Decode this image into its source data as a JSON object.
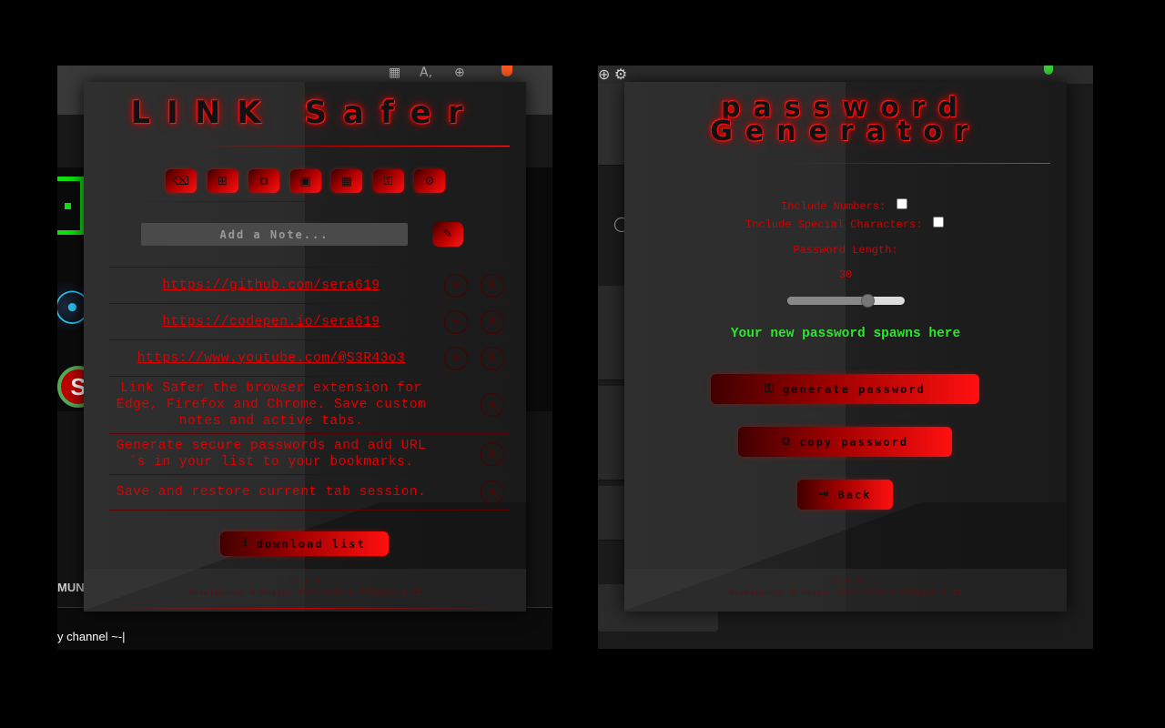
{
  "left_background": {
    "bottom_caption": "MUN",
    "channel_text": "y channel ~-|"
  },
  "link_safer": {
    "title": "LINK Safer",
    "toolbar": [
      {
        "icon": "eraser-icon",
        "glyph": "⌫"
      },
      {
        "icon": "add-bookmark-icon",
        "glyph": "⊞"
      },
      {
        "icon": "tab-copy-icon",
        "glyph": "⧉"
      },
      {
        "icon": "windows-icon",
        "glyph": "▣"
      },
      {
        "icon": "calendar-icon",
        "glyph": "▦"
      },
      {
        "icon": "key-icon",
        "glyph": "⚿"
      },
      {
        "icon": "gear-icon",
        "glyph": "⚙"
      }
    ],
    "note_placeholder": "Add a Note...",
    "note_save_icon": "✎",
    "items": [
      {
        "text": "https://github.com/sera619",
        "is_link": true,
        "has_add": true
      },
      {
        "text": "https://codepen.io/sera619",
        "is_link": true,
        "has_add": true
      },
      {
        "text": "https://www.youtube.com/@S3R43o3",
        "is_link": true,
        "has_add": true
      },
      {
        "text": "Link Safer the browser extension for Edge, Firefox and Chrome. Save custom notes and active tabs.",
        "is_link": false,
        "has_add": false
      },
      {
        "text": "Generate secure passwords and add URL´s in your list to your bookmarks.",
        "is_link": false,
        "has_add": false
      },
      {
        "text": "Save and restore current tab session.",
        "is_link": false,
        "has_add": false
      }
    ],
    "add_glyph": "+",
    "remove_glyph": "X",
    "download_label": "download list",
    "download_icon": "⭳",
    "version": "v2.3.5",
    "credits": "Development & Design 2022-2023 © S3R43o3 & XI"
  },
  "password_generator": {
    "title_line1": "password",
    "title_line2": "Generator",
    "include_numbers_label": "Include Numbers:",
    "include_special_label": "Include Special Characters:",
    "include_numbers_checked": false,
    "include_special_checked": false,
    "length_label": "Password Length:",
    "length_value": "30",
    "length_fraction": 0.68,
    "output_placeholder": "Your new password spawns here",
    "output_color": "#2ee62e",
    "generate_label": "generate password",
    "generate_icon": "⚿",
    "copy_label": "copy password",
    "copy_icon": "⧉",
    "back_label": "Back",
    "back_icon": "⇥",
    "version": "v1.5.8",
    "credits": "Development & Design 2022-2023 © S3R43o3 & XI"
  },
  "theme": {
    "accent": "#e00000",
    "accent_bright": "#ff1010",
    "panel": "#2a2a2a"
  }
}
